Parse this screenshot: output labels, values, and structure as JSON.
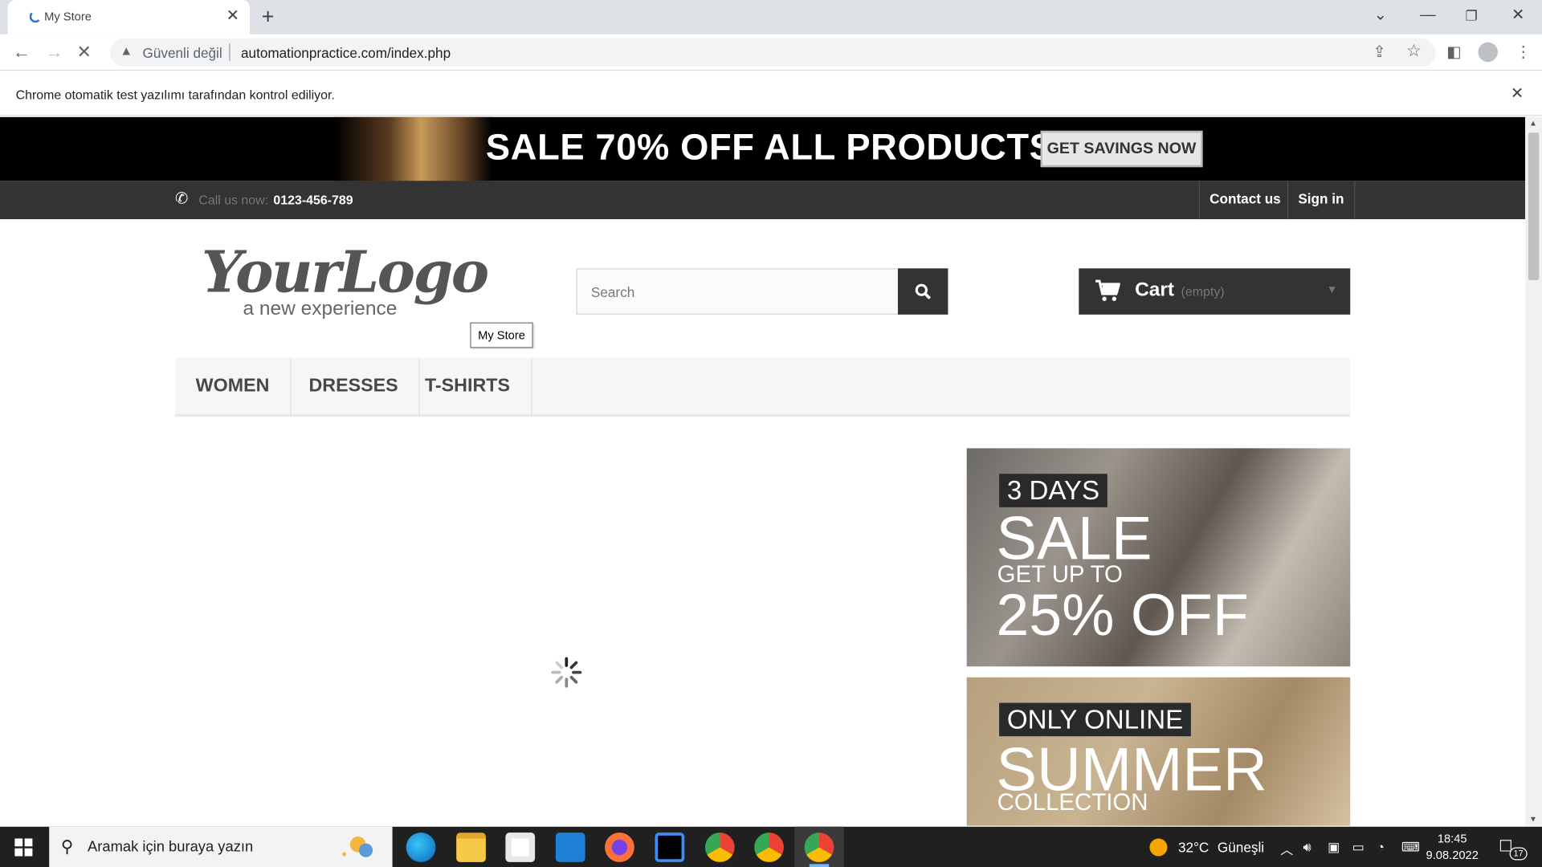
{
  "browser": {
    "tab_title": "My Store",
    "security_label": "Güvenli değil",
    "url": "automationpractice.com/index.php",
    "infobar_message": "Chrome otomatik test yazılımı tarafından kontrol ediliyor."
  },
  "banner": {
    "headline": "SALE 70% OFF ALL PRODUCTS",
    "button_label": "GET SAVINGS NOW"
  },
  "topbar": {
    "call_label": "Call us now:",
    "phone": "0123-456-789",
    "contact_label": "Contact us",
    "signin_label": "Sign in"
  },
  "header": {
    "logo_main": "YourLogo",
    "logo_tagline": "a new experience",
    "logo_tooltip": "My Store",
    "search_placeholder": "Search",
    "cart_label": "Cart",
    "cart_status": "(empty)"
  },
  "menu": {
    "items": [
      "WOMEN",
      "DRESSES",
      "T-SHIRTS"
    ]
  },
  "promos": [
    {
      "tag": "3 DAYS",
      "headline": "SALE",
      "sub": "GET UP TO",
      "offer": "25% OFF"
    },
    {
      "tag": "ONLY ONLINE",
      "headline": "SUMMER",
      "sub": "COLLECTION"
    }
  ],
  "taskbar": {
    "search_placeholder": "Aramak için buraya yazın",
    "weather_temp": "32°C",
    "weather_text": "Güneşli",
    "time": "18:45",
    "date": "9.08.2022",
    "notification_count": "17"
  },
  "colors": {
    "dark_bar": "#333333",
    "menu_bg": "#f6f6f6",
    "taskbar": "#202020"
  }
}
